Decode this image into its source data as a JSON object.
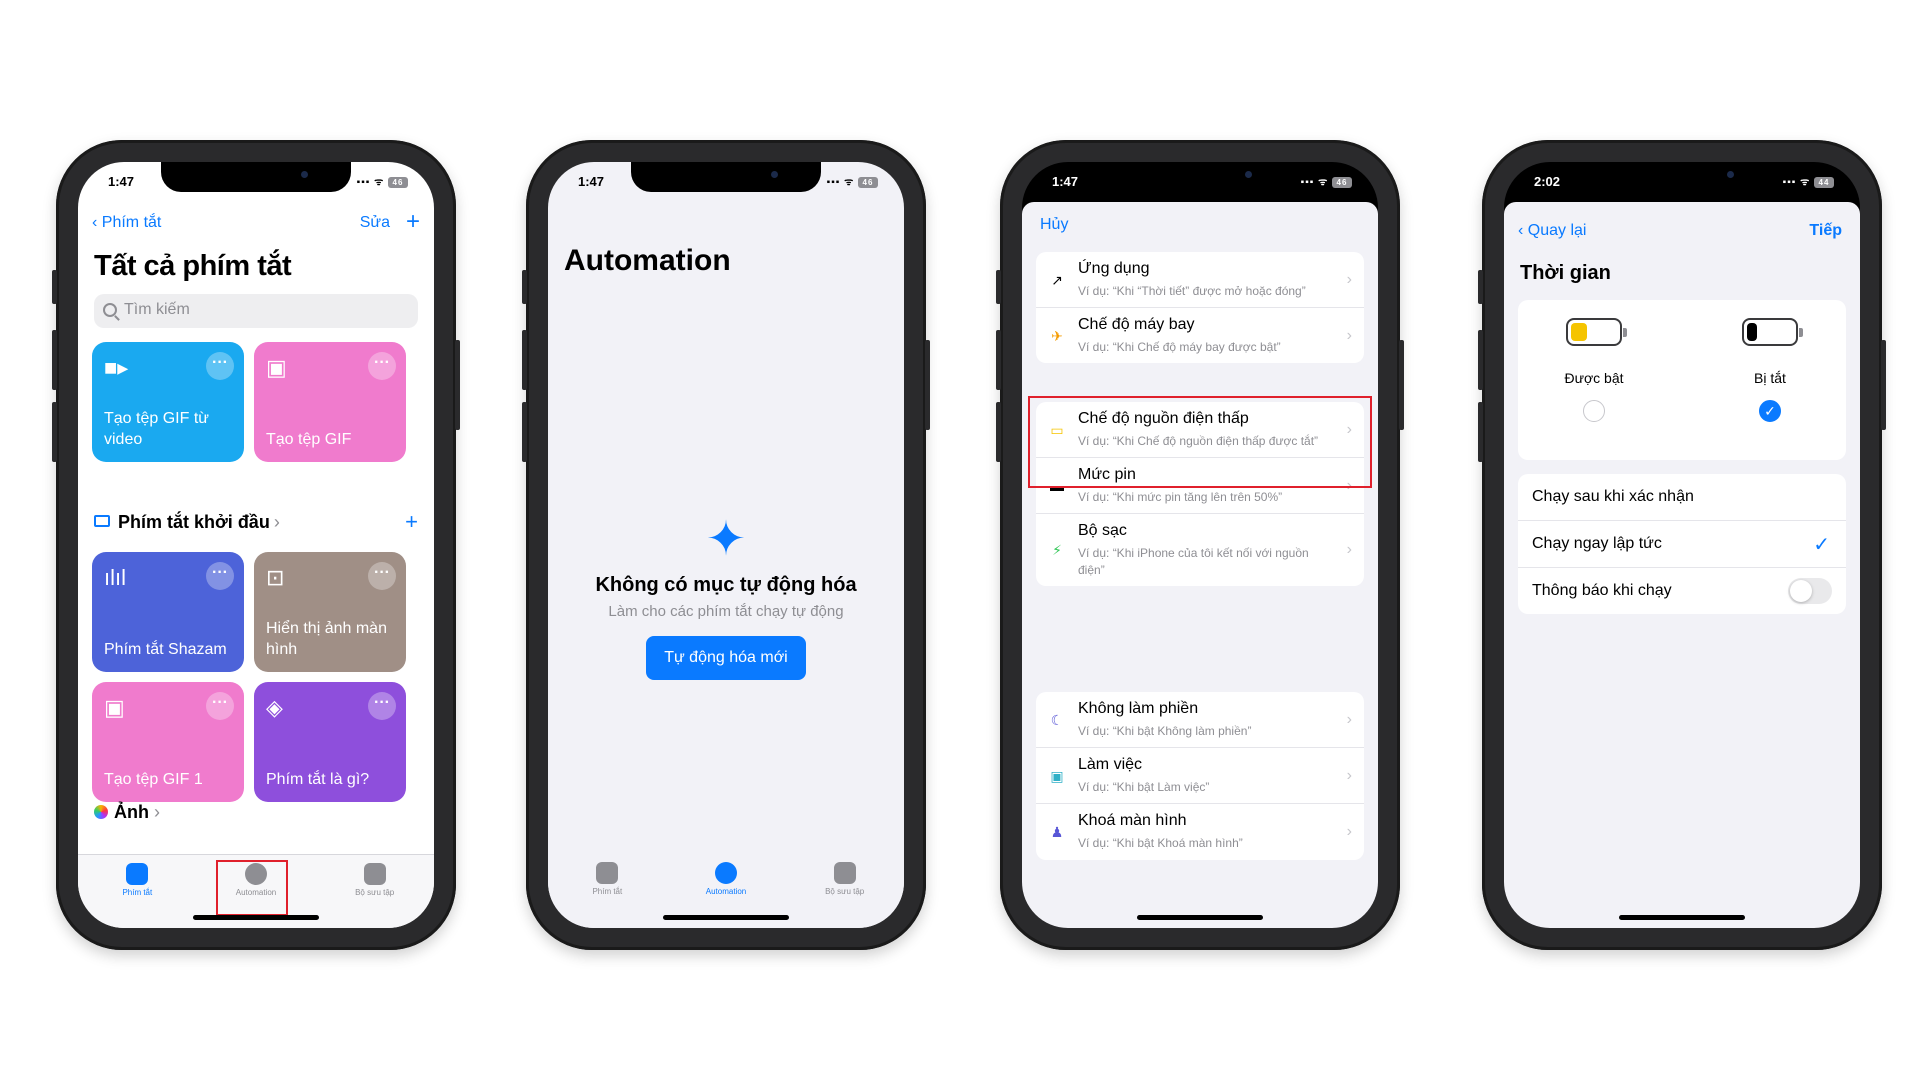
{
  "colors": {
    "accent": "#0a7aff",
    "highlight": "#e0202c"
  },
  "phone1": {
    "status": {
      "time": "1:47",
      "signal": "..ıl",
      "battery": "46"
    },
    "nav": {
      "back_label": "Phím tắt",
      "edit_label": "Sửa",
      "add_icon": "plus-icon"
    },
    "title": "Tất cả phím tắt",
    "search_placeholder": "Tìm kiếm",
    "cards_top": [
      {
        "label": "Tạo tệp GIF từ video",
        "color": "#1aa9f0",
        "icon": "video-camera-icon"
      },
      {
        "label": "Tạo tệp GIF",
        "color": "#f07bcd",
        "icon": "photos-icon"
      }
    ],
    "section": {
      "label": "Phím tắt khởi đầu"
    },
    "cards_bottom": [
      {
        "label": "Phím tắt Shazam",
        "color": "#4d63d9",
        "icon": "waveform-icon"
      },
      {
        "label": "Hiển thị ảnh màn hình",
        "color": "#a08f86",
        "icon": "screenshot-icon"
      },
      {
        "label": "Tạo tệp GIF 1",
        "color": "#f07bcd",
        "icon": "photos-icon"
      },
      {
        "label": "Phím tắt là gì?",
        "color": "#8e4fdc",
        "icon": "shortcuts-icon"
      }
    ],
    "photos_section": "Ảnh",
    "tabs": [
      {
        "label": "Phím tắt",
        "active": true
      },
      {
        "label": "Automation",
        "active": false
      },
      {
        "label": "Bộ sưu tập",
        "active": false
      }
    ]
  },
  "phone2": {
    "status": {
      "time": "1:47",
      "battery": "46"
    },
    "title": "Automation",
    "empty_title": "Không có mục tự động hóa",
    "empty_subtitle": "Làm cho các phím tắt chạy tự động",
    "new_button": "Tự động hóa mới",
    "tabs": [
      {
        "label": "Phím tắt",
        "active": false
      },
      {
        "label": "Automation",
        "active": true
      },
      {
        "label": "Bộ sưu tập",
        "active": false
      }
    ]
  },
  "phone3": {
    "status": {
      "time": "1:47",
      "battery": "46"
    },
    "cancel_label": "Hủy",
    "group1": [
      {
        "title": "Ứng dụng",
        "subtitle": "Ví dụ: “Khi “Thời tiết” được mở hoặc đóng”",
        "icon": "app-arrow-icon"
      },
      {
        "title": "Chế độ máy bay",
        "subtitle": "Ví dụ: “Khi Chế độ máy bay được bật”",
        "icon": "airplane-icon"
      }
    ],
    "group2": [
      {
        "title": "Chế độ nguồn điện thấp",
        "subtitle": "Ví dụ: “Khi Chế độ nguồn điện thấp được tắt”",
        "icon": "low-power-battery-icon"
      },
      {
        "title": "Mức pin",
        "subtitle": "Ví dụ: “Khi mức pin tăng lên trên 50%”",
        "icon": "battery-icon"
      },
      {
        "title": "Bộ sạc",
        "subtitle": "Ví dụ: “Khi iPhone của tôi kết nối với nguồn điện”",
        "icon": "charging-battery-icon"
      }
    ],
    "group3": [
      {
        "title": "Không làm phiền",
        "subtitle": "Ví dụ: “Khi bật Không làm phiền”",
        "icon": "moon-icon"
      },
      {
        "title": "Làm việc",
        "subtitle": "Ví dụ: “Khi bật Làm việc”",
        "icon": "badge-icon"
      },
      {
        "title": "Khoá màn hình",
        "subtitle": "Ví dụ: “Khi bật Khoá màn hình”",
        "icon": "person-icon"
      }
    ]
  },
  "phone4": {
    "status": {
      "time": "2:02",
      "battery": "44"
    },
    "back_label": "Quay lại",
    "next_label": "Tiếp",
    "section_title": "Thời gian",
    "choices": [
      {
        "label": "Được bật",
        "selected": false,
        "fill_color": "#f5c400"
      },
      {
        "label": "Bị tắt",
        "selected": true,
        "fill_color": "#000000"
      }
    ],
    "options": [
      {
        "label": "Chạy sau khi xác nhận",
        "checked": false
      },
      {
        "label": "Chạy ngay lập tức",
        "checked": true
      },
      {
        "label": "Thông báo khi chạy",
        "toggle": false
      }
    ]
  }
}
